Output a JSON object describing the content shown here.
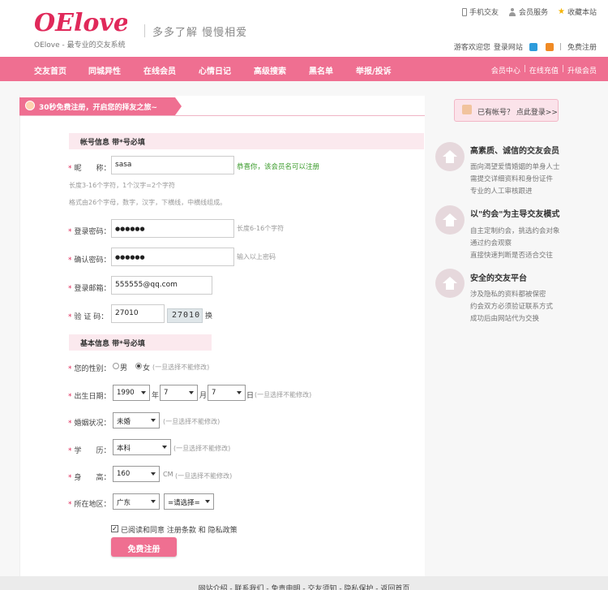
{
  "header": {
    "logo_text": "OElove",
    "tagline": "OElove - 最专业的交友系统",
    "slogan": "多多了解 慢慢相爱",
    "top_links": {
      "mobile": "手机交友",
      "member_service": "会员服务",
      "bookmark": "收藏本站"
    },
    "welcome": "游客欢迎您",
    "login": "登录网站",
    "register": "免费注册"
  },
  "nav": {
    "items": [
      "交友首页",
      "同城异性",
      "在线会员",
      "心情日记",
      "高级搜索",
      "黑名单",
      "举报/投诉"
    ],
    "right": [
      "会员中心",
      "在线充值",
      "升级会员"
    ]
  },
  "banner": "30秒免费注册，开启您的择友之旅~",
  "account": {
    "section_title": "帐号信息 带*号必填",
    "nickname_label": "昵　　称：",
    "nickname_value": "sasa",
    "nickname_ok": "恭喜你，该会员名可以注册",
    "nickname_hint1": "长度3-16个字符，1个汉字=2个字符",
    "nickname_hint2": "格式由26个字母，数字，汉字，下横线，中横线组成。",
    "password_label": "登录密码：",
    "password_value": "●●●●●●",
    "password_hint": "长度6-16个字符",
    "confirm_label": "确认密码：",
    "confirm_value": "●●●●●●",
    "confirm_hint": "输入以上密码",
    "email_label": "登录邮箱：",
    "email_value": "555555@qq.com",
    "captcha_label": "验 证 码：",
    "captcha_value": "27010",
    "captcha_image": "27010",
    "captcha_refresh": "换"
  },
  "basic": {
    "section_title": "基本信息 带*号必填",
    "gender_label": "您的性别：",
    "male": "男",
    "female": "女",
    "gender_note": "(一旦选择不能修改)",
    "birth_label": "出生日期：",
    "year": "1990",
    "year_unit": "年",
    "month": "7",
    "month_unit": "月",
    "day": "7",
    "day_unit": "日",
    "birth_note": "(一旦选择不能修改)",
    "marital_label": "婚姻状况：",
    "marital": "未婚",
    "marital_note": "(一旦选择不能修改)",
    "education_label": "学　　历：",
    "education": "本科",
    "education_note": "(一旦选择不能修改)",
    "height_label": "身　　高：",
    "height": "160",
    "height_unit": "CM",
    "height_note": "(一旦选择不能修改)",
    "region_label": "所在地区：",
    "province": "广东",
    "city": "=请选择=",
    "agree_text": "已阅读和同意 注册条款 和 隐私政策",
    "submit": "免费注册"
  },
  "sidebar": {
    "have_account": "已有帐号？ 点此登录>>",
    "features": [
      {
        "title": "高素质、诚信的交友会员",
        "lines": [
          "面向渴望爱情婚姻的单身人士",
          "需提交详细资料和身份证件",
          "专业的人工审核跟进"
        ]
      },
      {
        "title": "以\"约会\"为主导交友模式",
        "lines": [
          "自主定制约会，挑选约会对象",
          "通过约会观察",
          "直接快速判断是否适合交往"
        ]
      },
      {
        "title": "安全的交友平台",
        "lines": [
          "涉及隐私的资料都被保密",
          "约会双方必须验证联系方式",
          "成功后由网站代为交换"
        ]
      }
    ]
  },
  "footer": {
    "links": "网站介绍 - 联系我们 - 免责申明 - 交友须知 - 隐私保护 - 返回首页"
  },
  "colors": {
    "brand_pink": "#ef6f91",
    "success_green": "#3a9b2b",
    "required_red": "#e0295a"
  },
  "icons": [
    "phone-icon",
    "user-icon",
    "star-icon",
    "qq-icon",
    "weibo-icon",
    "avatar-icon",
    "house-icon"
  ]
}
